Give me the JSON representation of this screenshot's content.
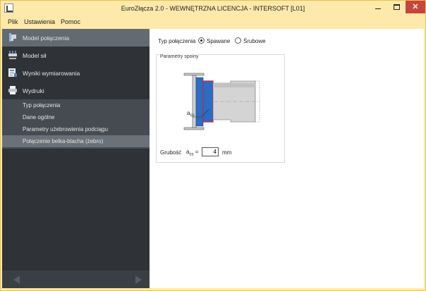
{
  "window": {
    "title": "EuroZłącza 2.0 - WEWNĘTRZNA LICENCJA - INTERSOFT [L01]",
    "minimize_label": "",
    "maximize_label": "",
    "close_label": "✕"
  },
  "menu": {
    "items": [
      {
        "label": "Plik"
      },
      {
        "label": "Ustawienia"
      },
      {
        "label": "Pomoc"
      }
    ]
  },
  "sidebar": {
    "items": [
      {
        "label": "Model połączenia",
        "icon": "connection-model-icon",
        "active": true
      },
      {
        "label": "Model sił",
        "icon": "forces-model-icon",
        "active": false
      },
      {
        "label": "Wyniki wymiarowania",
        "icon": "results-icon",
        "active": false
      },
      {
        "label": "Wydruki",
        "icon": "printer-icon",
        "active": false
      }
    ],
    "subitems": [
      {
        "label": "Typ połączenia",
        "active": false
      },
      {
        "label": "Dane ogólne",
        "active": false
      },
      {
        "label": "Parametry użebrowienia podciągu",
        "active": false
      },
      {
        "label": "Połączenie belka-blacha (żebro)",
        "active": true
      }
    ]
  },
  "main": {
    "connection_type_label": "Typ połączenia",
    "options": [
      {
        "label": "Spawane",
        "checked": true
      },
      {
        "label": "Śrubowe",
        "checked": false
      }
    ],
    "weld_group": {
      "title": "Parametry spoiny",
      "diagram_label_base": "a",
      "diagram_label_sub": "cs"
    },
    "thickness": {
      "label": "Grubość",
      "symbol_base": "a",
      "symbol_sub": "cs",
      "equals": "=",
      "value": "4",
      "unit": "mm"
    }
  },
  "colors": {
    "sidebar_bg": "#2f3337",
    "sidebar_active": "#626a72",
    "titlebar_bg": "#fde9aa",
    "close_button": "#c7453a",
    "plate_fill": "#2b6cc4",
    "weld_line": "#d61f3a",
    "beam_fill": "#d4d4d4"
  }
}
